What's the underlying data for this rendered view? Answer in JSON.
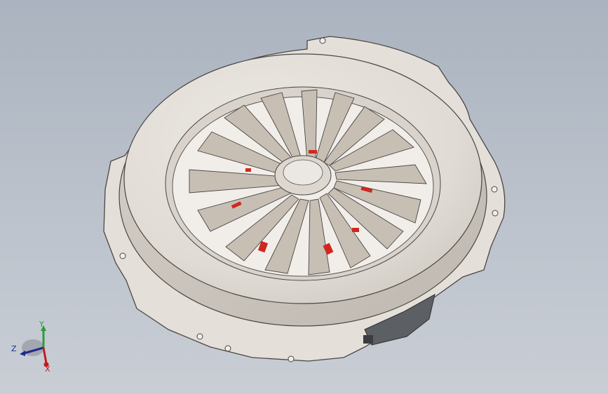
{
  "viewport": {
    "background_top": "#aab3bf",
    "background_bottom": "#c9ced5"
  },
  "model": {
    "part_color": "#e3ded8",
    "edge_color": "#4a4744",
    "shadow_color": "#b8b2ab",
    "accent_color": "#d0281e",
    "bracket_color": "#5c5f63"
  },
  "triad": {
    "y_label": "Y",
    "z_label": "Z",
    "x_label": "X",
    "y_color": "#2e9a3c",
    "z_color": "#1e2b8a",
    "x_color": "#c21c1c"
  }
}
